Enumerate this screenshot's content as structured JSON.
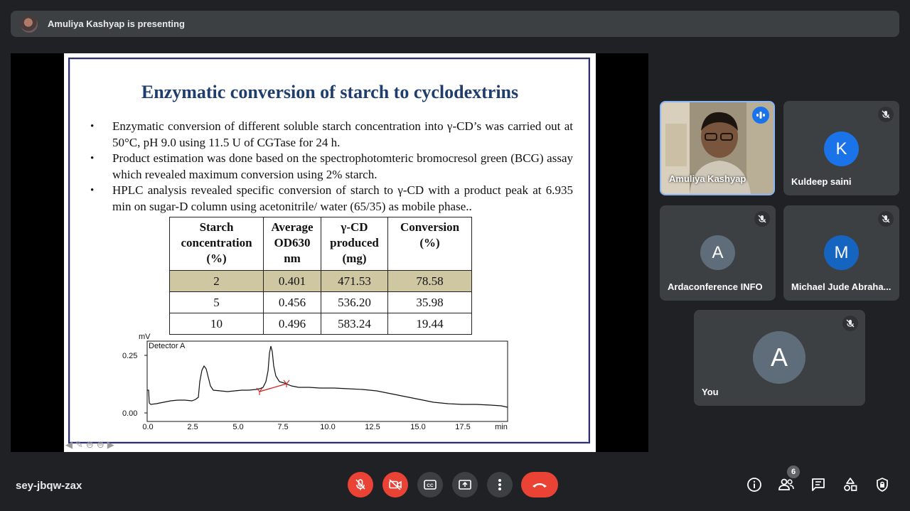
{
  "presenting_banner": {
    "text": "Amuliya Kashyap is presenting"
  },
  "slide": {
    "title": "Enzymatic conversion of starch to cyclodextrins",
    "bullets": [
      "Enzymatic conversion of different soluble starch concentration into γ-CD’s was carried out at 50°C, pH 9.0 using 11.5 U of CGTase for 24 h.",
      "Product estimation was done based on the spectrophotomteric bromocresol green (BCG) assay which revealed maximum conversion using 2% starch.",
      "HPLC analysis revealed specific conversion of starch to γ-CD with a product peak at 6.935 min on sugar-D column using acetonitrile/ water (65/35) as mobile phase.."
    ],
    "table": {
      "headers": [
        "Starch concentration (%)",
        "Average OD630 nm",
        "γ-CD produced (mg)",
        "Conversion (%)"
      ],
      "rows": [
        [
          "2",
          "0.401",
          "471.53",
          "78.58"
        ],
        [
          "5",
          "0.456",
          "536.20",
          "35.98"
        ],
        [
          "10",
          "0.496",
          "583.24",
          "19.44"
        ]
      ]
    },
    "chromatogram": {
      "y_unit": "mV",
      "detector_label": "Detector A",
      "y_ticks": [
        "0.25",
        "0.00"
      ],
      "x_ticks": [
        "0.0",
        "2.5",
        "5.0",
        "7.5",
        "10.0",
        "12.5",
        "15.0",
        "17.5",
        "min"
      ]
    }
  },
  "participants": [
    {
      "name": "Amuliya Kashyap",
      "type": "video",
      "speaking": true
    },
    {
      "name": "Kuldeep saini",
      "initial": "K",
      "avatar_color": "#1a73e8",
      "muted": true
    },
    {
      "name": "Ardaconference INFO",
      "initial": "A",
      "avatar_color": "#5f6d7a",
      "muted": true
    },
    {
      "name": "Michael Jude Abraha...",
      "initial": "M",
      "avatar_color": "#1565c0",
      "muted": true
    },
    {
      "name": "You",
      "initial": "A",
      "avatar_color": "#5f6d7a",
      "muted": true
    }
  ],
  "bottom_bar": {
    "meeting_code": "sey-jbqw-zax",
    "participant_count": "6",
    "controls": [
      "mic-off",
      "camera-off",
      "captions",
      "present",
      "more-options",
      "leave-call"
    ],
    "right_controls": [
      "info",
      "people",
      "chat",
      "activities",
      "host-controls"
    ]
  },
  "colors": {
    "background": "#202124",
    "surface": "#3c4043",
    "danger": "#ea4335",
    "accent": "#1a73e8",
    "slide_title": "#1f3e6e",
    "highlight_row": "#cfc6a2"
  }
}
